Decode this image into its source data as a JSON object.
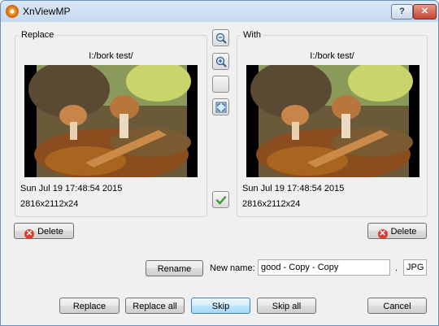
{
  "window": {
    "title": "XnViewMP",
    "help_label": "?",
    "close_label": "✕"
  },
  "replace": {
    "group_title": "Replace",
    "path": "I:/bork test/",
    "date": "Sun Jul 19 17:48:54 2015",
    "dimensions": "2816x2112x24"
  },
  "with": {
    "group_title": "With",
    "path": "I:/bork test/",
    "date": "Sun Jul 19 17:48:54 2015",
    "dimensions": "2816x2112x24"
  },
  "side_icons": [
    "zoom-out-icon",
    "zoom-in-icon",
    "blank-icon",
    "fit-window-icon",
    "checkmark-icon"
  ],
  "buttons": {
    "delete_left": "Delete",
    "delete_right": "Delete",
    "rename": "Rename",
    "replace": "Replace",
    "replace_all": "Replace all",
    "skip": "Skip",
    "skip_all": "Skip all",
    "cancel": "Cancel"
  },
  "rename": {
    "new_name_label": "New name:",
    "new_name_value": "good - Copy - Copy",
    "dot": ".",
    "extension": "JPG"
  },
  "colors": {
    "accent": "#3c7fb1",
    "delete_icon": "#e03c31",
    "check": "#3a9a2f"
  }
}
